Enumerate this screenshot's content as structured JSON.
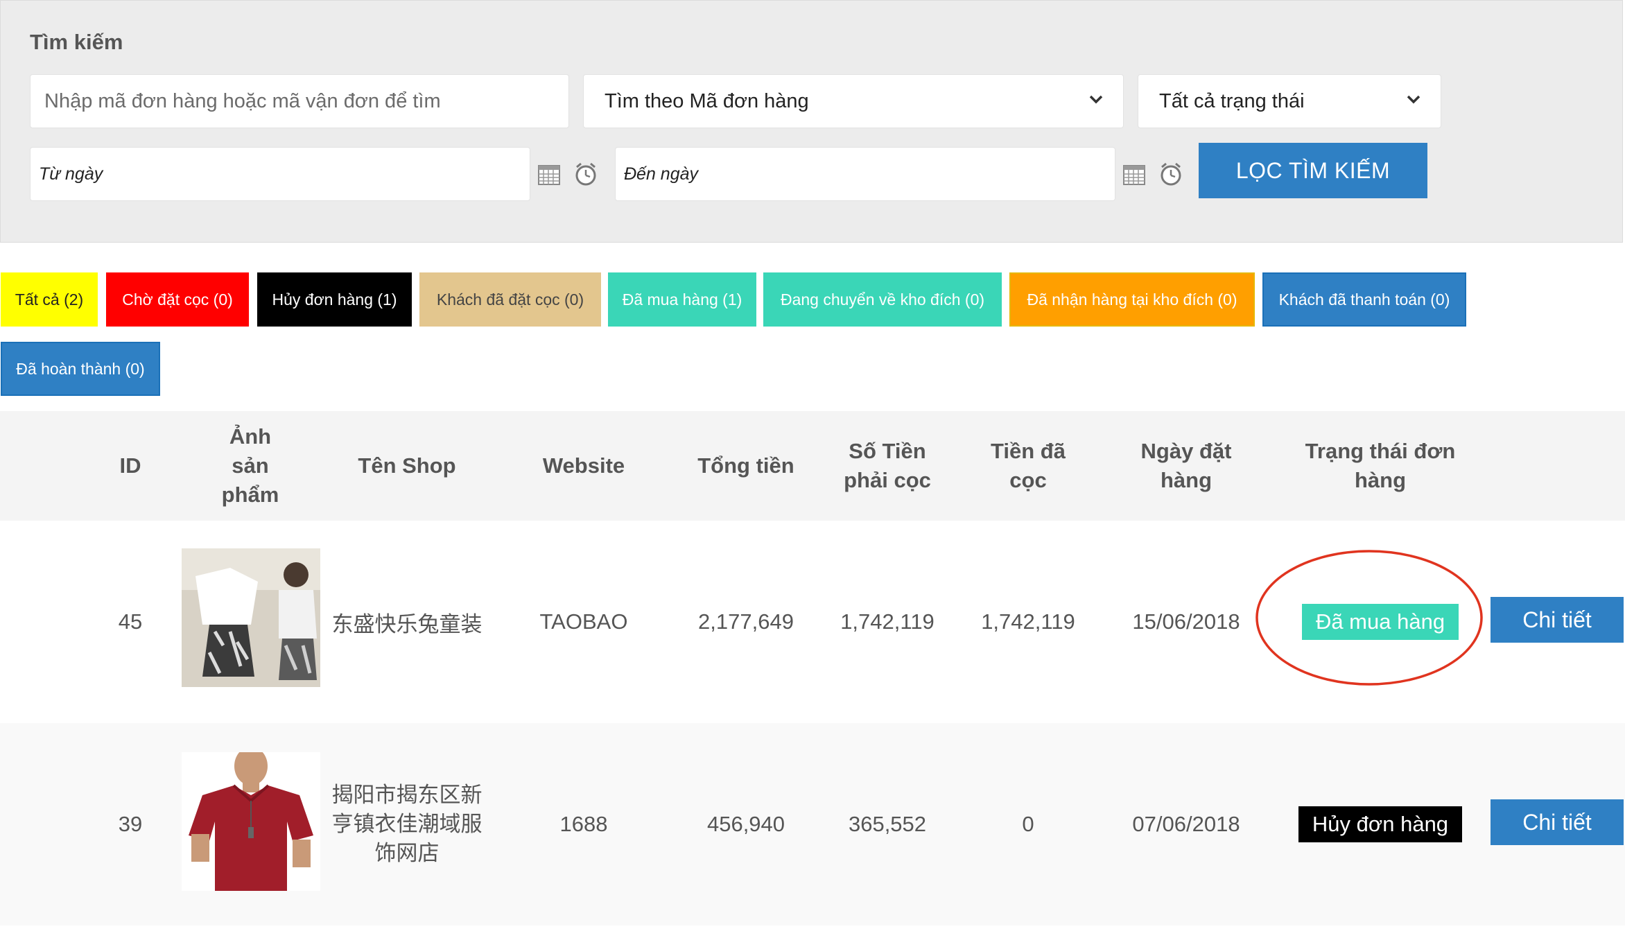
{
  "search": {
    "title": "Tìm kiếm",
    "code_placeholder": "Nhập mã đơn hàng hoặc mã vận đơn để tìm",
    "search_by_value": "Tìm theo Mã đơn hàng",
    "status_value": "Tất cả trạng thái",
    "from_date_placeholder": "Từ ngày",
    "to_date_placeholder": "Đến ngày",
    "filter_button": "LỌC TÌM KIẾM"
  },
  "status_filters": [
    {
      "label": "Tất cả (2)",
      "bg": "#ffff00",
      "fg": "#222222"
    },
    {
      "label": "Chờ đặt cọc (0)",
      "bg": "#ff0000",
      "fg": "#ffffff"
    },
    {
      "label": "Hủy đơn hàng (1)",
      "bg": "#000000",
      "fg": "#ffffff"
    },
    {
      "label": "Khách đã đặt cọc (0)",
      "bg": "#e3c68e",
      "fg": "#444444"
    },
    {
      "label": "Đã mua hàng (1)",
      "bg": "#3ad6b7",
      "fg": "#ffffff"
    },
    {
      "label": "Đang chuyển về kho đích (0)",
      "bg": "#3ad6b7",
      "fg": "#ffffff"
    },
    {
      "label": "Đã nhận hàng tại kho đích (0)",
      "bg": "#ff9f00",
      "fg": "#ffffff"
    },
    {
      "label": "Khách đã thanh toán (0)",
      "bg": "#2f80c4",
      "fg": "#ffffff"
    },
    {
      "label": "Đã hoàn thành (0)",
      "bg": "#2f80c4",
      "fg": "#ffffff"
    }
  ],
  "table": {
    "headers": {
      "id": "ID",
      "image": "Ảnh sản phẩm",
      "shop": "Tên Shop",
      "website": "Website",
      "total": "Tổng tiền",
      "deposit_required": "Số Tiền phải cọc",
      "deposit_paid": "Tiền đã cọc",
      "order_date": "Ngày đặt hàng",
      "status": "Trạng thái đơn hàng"
    },
    "rows": [
      {
        "id": "45",
        "shop": "东盛快乐兔童装",
        "website": "TAOBAO",
        "total": "2,177,649",
        "deposit_required": "1,742,119",
        "deposit_paid": "1,742,119",
        "order_date": "15/06/2018",
        "status": "Đã mua hàng",
        "status_color": "#3ad6b7",
        "detail": "Chi tiết"
      },
      {
        "id": "39",
        "shop": "揭阳市揭东区新亨镇衣佳潮域服饰网店",
        "website": "1688",
        "total": "456,940",
        "deposit_required": "365,552",
        "deposit_paid": "0",
        "order_date": "07/06/2018",
        "status": "Hủy đơn hàng",
        "status_color": "#000000",
        "detail": "Chi tiết"
      }
    ]
  },
  "colors": {
    "primary": "#2f80c4",
    "highlight_ring": "#e0341f"
  }
}
